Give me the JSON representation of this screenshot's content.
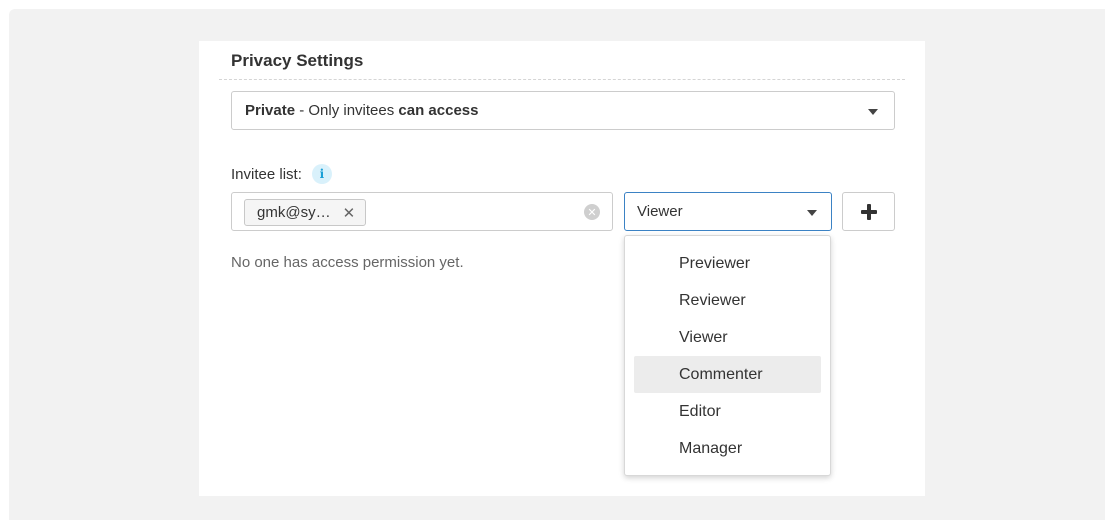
{
  "privacy": {
    "title": "Privacy Settings",
    "select_bold_prefix": "Private",
    "select_middle": " - Only invitees ",
    "select_bold_suffix": "can access"
  },
  "invitees": {
    "label": "Invitee list:",
    "info_icon": "info-icon",
    "chip_text": "gmk@sy…",
    "chip_remove": "✕",
    "empty_message": "No one has access permission yet."
  },
  "role_select": {
    "selected": "Viewer",
    "options": [
      "Previewer",
      "Reviewer",
      "Viewer",
      "Commenter",
      "Editor",
      "Manager"
    ],
    "hovered": "Commenter"
  },
  "colors": {
    "focus_border": "#3b82c4",
    "info_accent": "#1a9fd6",
    "hover_bg": "#ececec"
  }
}
